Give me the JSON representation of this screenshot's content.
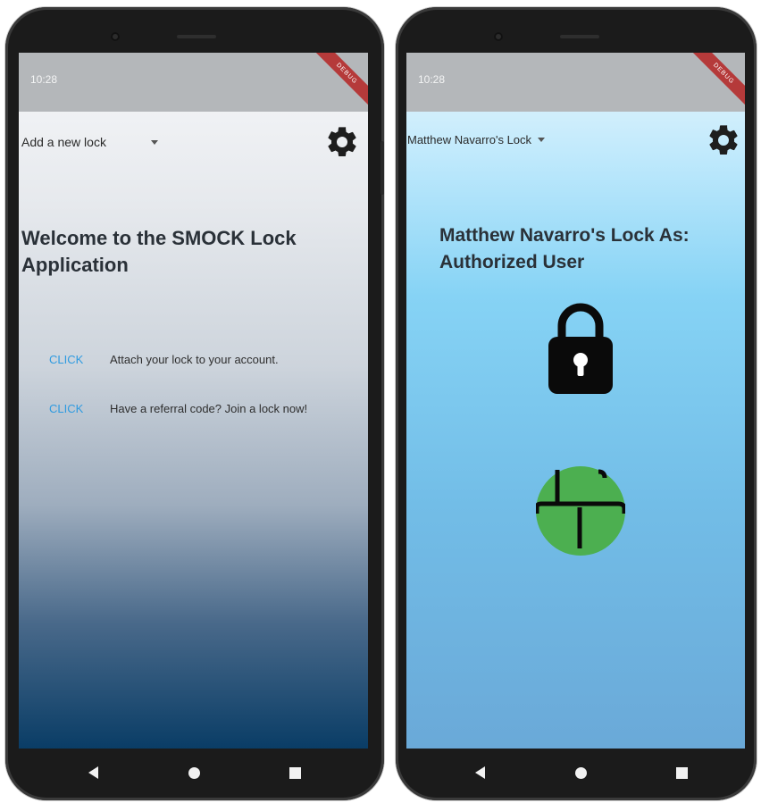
{
  "left_phone": {
    "status_time": "10:28",
    "debug_label": "DEBUG",
    "dropdown_selected": "Add a new lock",
    "heading": "Welcome to the SMOCK Lock Application",
    "rows": [
      {
        "link": "CLICK",
        "text": "Attach your lock to your account."
      },
      {
        "link": "CLICK",
        "text": "Have a referral code? Join a lock now!"
      }
    ]
  },
  "right_phone": {
    "status_time": "10:28",
    "debug_label": "DEBUG",
    "dropdown_selected": "Matthew Navarro's Lock",
    "heading": "Matthew Navarro's Lock As: Authorized User",
    "lock_status_icon": "lock-closed-icon",
    "unlock_button_icon": "unlock-toggle-icon"
  },
  "colors": {
    "link_blue": "#2f9be0",
    "unlock_green": "#4caf50",
    "debug_red": "#b53a3a"
  },
  "icons": {
    "settings": "gear-icon",
    "back": "back-triangle-icon",
    "home": "home-circle-icon",
    "recents": "recents-square-icon"
  }
}
